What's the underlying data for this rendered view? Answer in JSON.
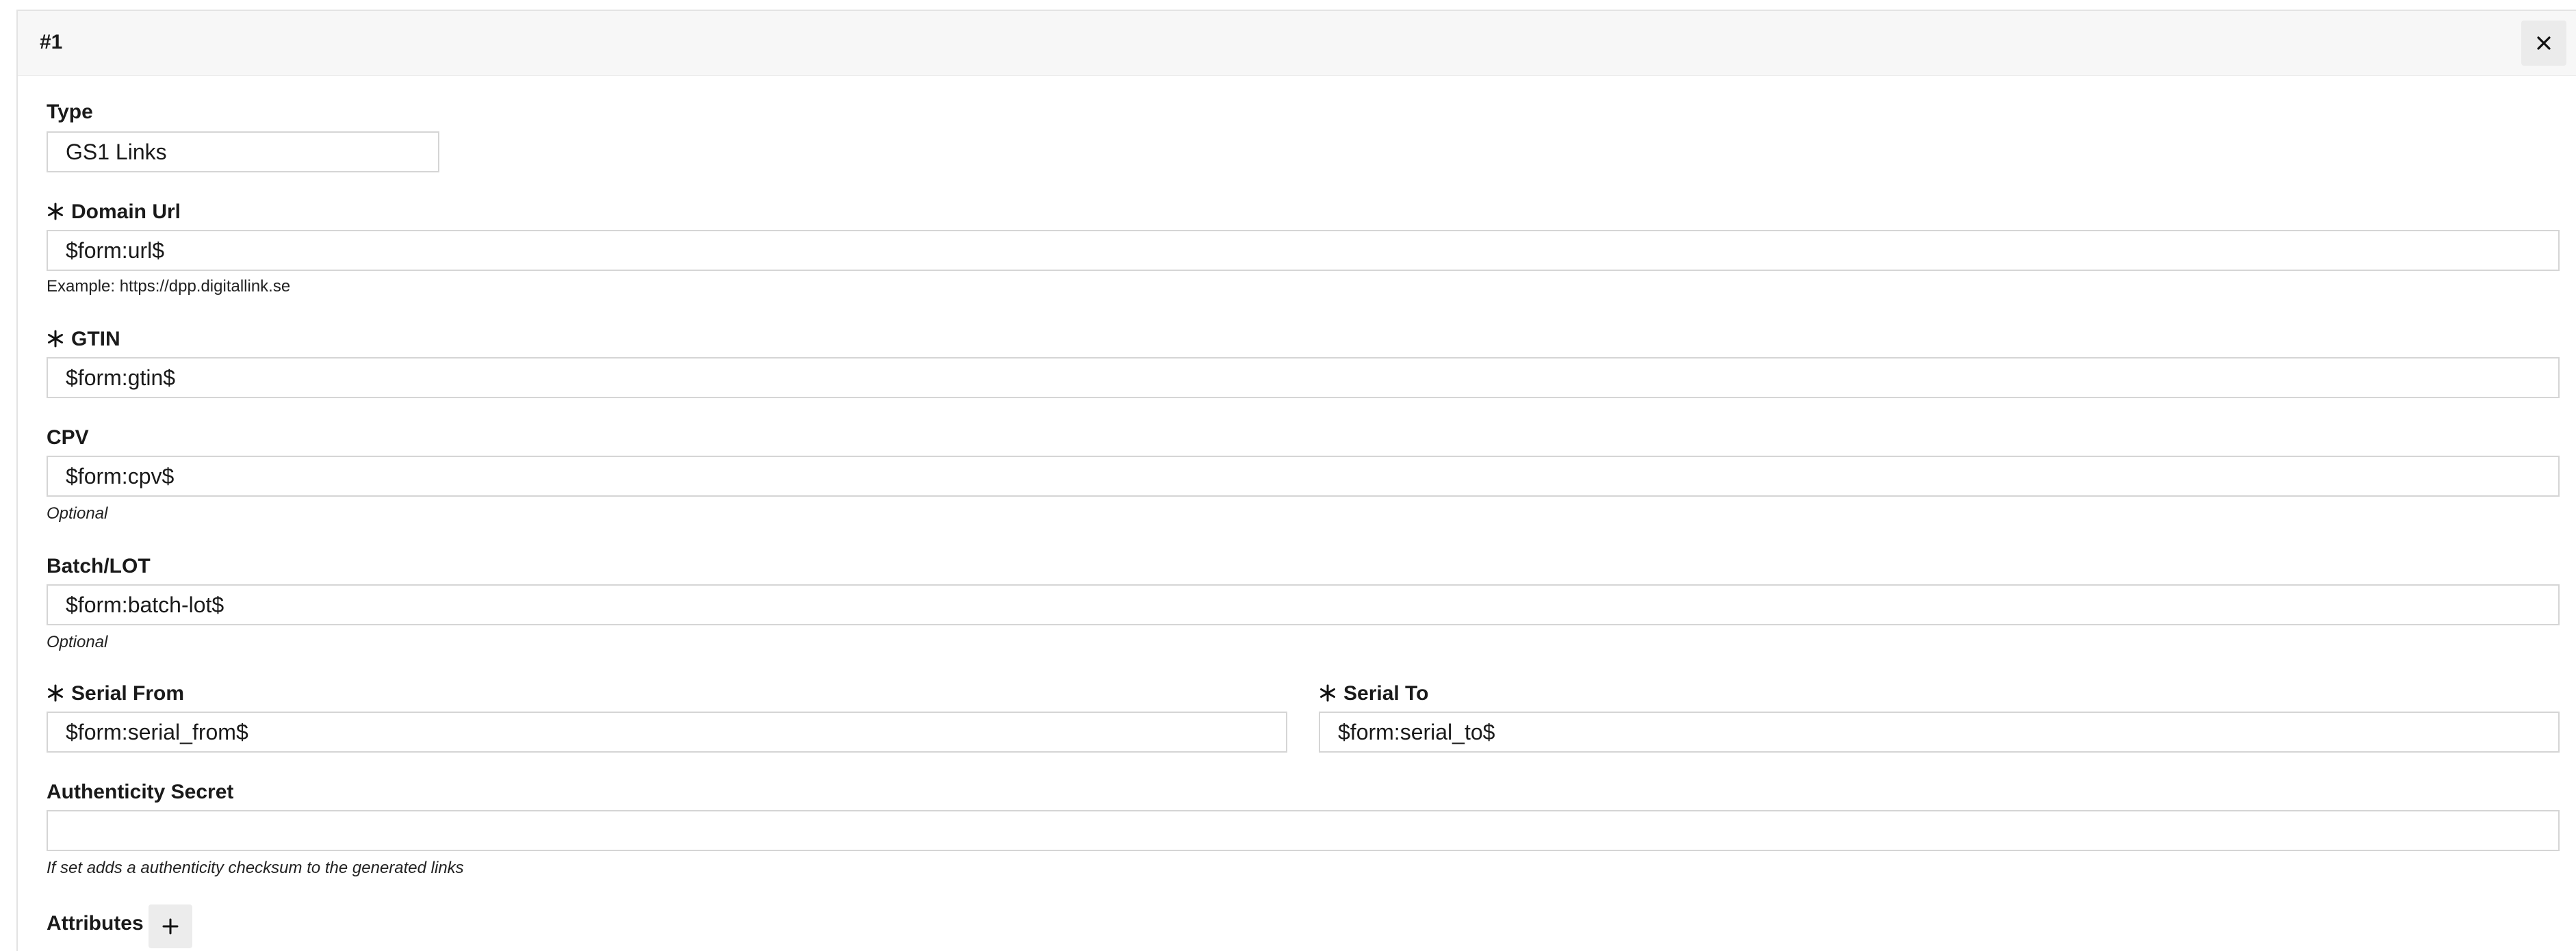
{
  "panel": {
    "title": "#1"
  },
  "fields": {
    "type": {
      "label": "Type",
      "value": "GS1 Links"
    },
    "domain_url": {
      "label": "Domain Url",
      "value": "$form:url$",
      "hint": "Example: https://dpp.digitallink.se"
    },
    "gtin": {
      "label": "GTIN",
      "value": "$form:gtin$"
    },
    "cpv": {
      "label": "CPV",
      "value": "$form:cpv$",
      "hint": "Optional"
    },
    "batch_lot": {
      "label": "Batch/LOT",
      "value": "$form:batch-lot$",
      "hint": "Optional"
    },
    "serial_from": {
      "label": "Serial From",
      "value": "$form:serial_from$"
    },
    "serial_to": {
      "label": "Serial To",
      "value": "$form:serial_to$"
    },
    "authenticity_secret": {
      "label": "Authenticity Secret",
      "value": "",
      "hint": "If set adds a authenticity checksum to the generated links"
    },
    "attributes": {
      "label": "Attributes"
    }
  },
  "icons": {
    "close": "close-icon",
    "required": "asterisk-icon",
    "add": "plus-icon"
  }
}
